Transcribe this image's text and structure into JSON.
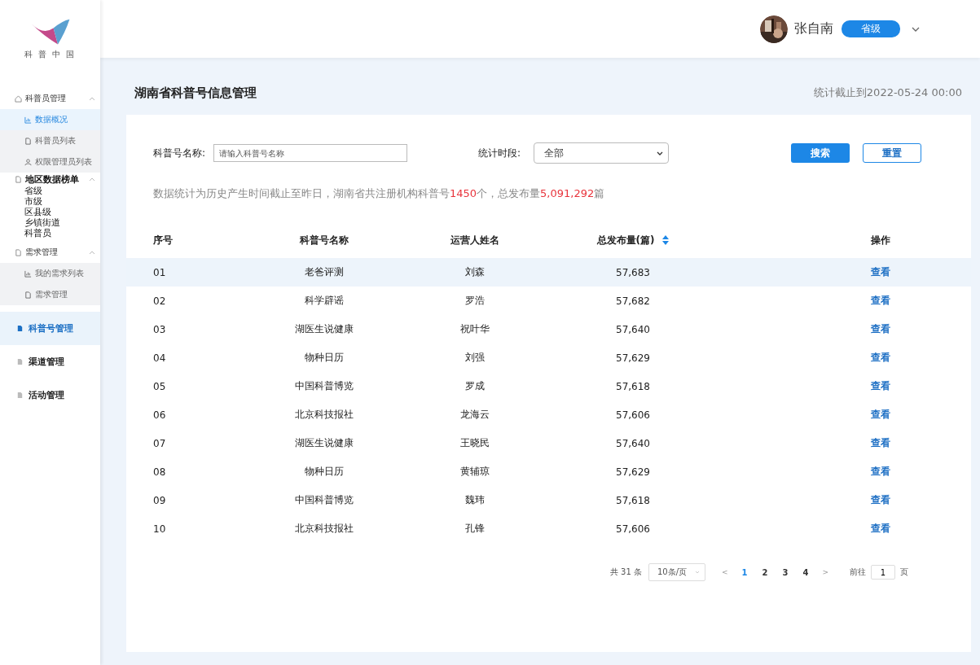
{
  "sidebar": {
    "logo_text": "科 普 中 国",
    "groups": [
      {
        "label": "科普员管理",
        "kind": "small",
        "expanded": true,
        "children": [
          {
            "label": "数据概况",
            "kind": "chart",
            "selected": true
          },
          {
            "label": "科普员列表",
            "kind": "doc",
            "selected": false
          },
          {
            "label": "权限管理员列表",
            "kind": "person",
            "selected": false
          }
        ]
      },
      {
        "label": "地区数据榜单",
        "kind": "bold",
        "expanded": true,
        "children": [
          {
            "label": "省级",
            "kind": "plain",
            "selected": false
          },
          {
            "label": "市级",
            "kind": "plain",
            "selected": false
          },
          {
            "label": "区县级",
            "kind": "plain",
            "selected": false
          },
          {
            "label": "乡镇街道",
            "kind": "plain",
            "selected": false
          },
          {
            "label": "科普员",
            "kind": "plain",
            "selected": false
          }
        ]
      },
      {
        "label": "需求管理",
        "kind": "small",
        "expanded": true,
        "children": [
          {
            "label": "我的需求列表",
            "kind": "chart",
            "selected": false
          },
          {
            "label": "需求管理",
            "kind": "doc",
            "selected": false
          }
        ]
      }
    ],
    "sections": [
      {
        "label": "科普号管理",
        "selected": true
      },
      {
        "label": "渠道管理",
        "selected": false
      },
      {
        "label": "活动管理",
        "selected": false
      }
    ]
  },
  "header": {
    "user_name": "张自南",
    "role_badge": "省级"
  },
  "page": {
    "title": "湖南省科普号信息管理",
    "updated": "统计截止到2022-05-24 00:00"
  },
  "filters": {
    "name_label": "科普号名称:",
    "name_placeholder": "请输入科普号名称",
    "period_label": "统计时段:",
    "period_value": "全部",
    "search_button": "搜索",
    "reset_button": "重置"
  },
  "summary": [
    {
      "text": "数据统计为历史产生时间截止至昨日，湖南省共注册机构科普号",
      "highlight": false
    },
    {
      "text": "1450",
      "highlight": true
    },
    {
      "text": "个，总发布量",
      "highlight": false
    },
    {
      "text": "5,091,292",
      "highlight": true
    },
    {
      "text": "篇",
      "highlight": false
    }
  ],
  "table": {
    "columns": [
      {
        "label": "序号",
        "sortable": false
      },
      {
        "label": "科普号名称",
        "sortable": false
      },
      {
        "label": "运营人姓名",
        "sortable": false
      },
      {
        "label": "总发布量(篇)",
        "sortable": true
      },
      {
        "label": "操作",
        "sortable": false
      }
    ],
    "rows": [
      {
        "index": "01",
        "name": "老爸评测",
        "operator": "刘森",
        "total": "57,683",
        "action": "查看",
        "highlighted": true
      },
      {
        "index": "02",
        "name": "科学辟谣",
        "operator": "罗浩",
        "total": "57,682",
        "action": "查看",
        "highlighted": false
      },
      {
        "index": "03",
        "name": "湖医生说健康",
        "operator": "祝叶华",
        "total": "57,640",
        "action": "查看",
        "highlighted": false
      },
      {
        "index": "04",
        "name": "物种日历",
        "operator": "刘强",
        "total": "57,629",
        "action": "查看",
        "highlighted": false
      },
      {
        "index": "05",
        "name": "中国科普博览",
        "operator": "罗成",
        "total": "57,618",
        "action": "查看",
        "highlighted": false
      },
      {
        "index": "06",
        "name": "北京科技报社",
        "operator": "龙海云",
        "total": "57,606",
        "action": "查看",
        "highlighted": false
      },
      {
        "index": "07",
        "name": "湖医生说健康",
        "operator": "王晓民",
        "total": "57,640",
        "action": "查看",
        "highlighted": false
      },
      {
        "index": "08",
        "name": "物种日历",
        "operator": "黄辅琼",
        "total": "57,629",
        "action": "查看",
        "highlighted": false
      },
      {
        "index": "09",
        "name": "中国科普博览",
        "operator": "魏玮",
        "total": "57,618",
        "action": "查看",
        "highlighted": false
      },
      {
        "index": "10",
        "name": "北京科技报社",
        "operator": "孔锋",
        "total": "57,606",
        "action": "查看",
        "highlighted": false
      }
    ]
  },
  "pagination": {
    "total": "共 31 条",
    "page_size": "10条/页",
    "prev": "<",
    "pages": [
      {
        "label": "1",
        "selected": true
      },
      {
        "label": "2",
        "selected": false
      },
      {
        "label": "3",
        "selected": false
      },
      {
        "label": "4",
        "selected": false
      }
    ],
    "next": ">",
    "goto_label": "前往",
    "goto_value": "1",
    "goto_unit": "页"
  }
}
